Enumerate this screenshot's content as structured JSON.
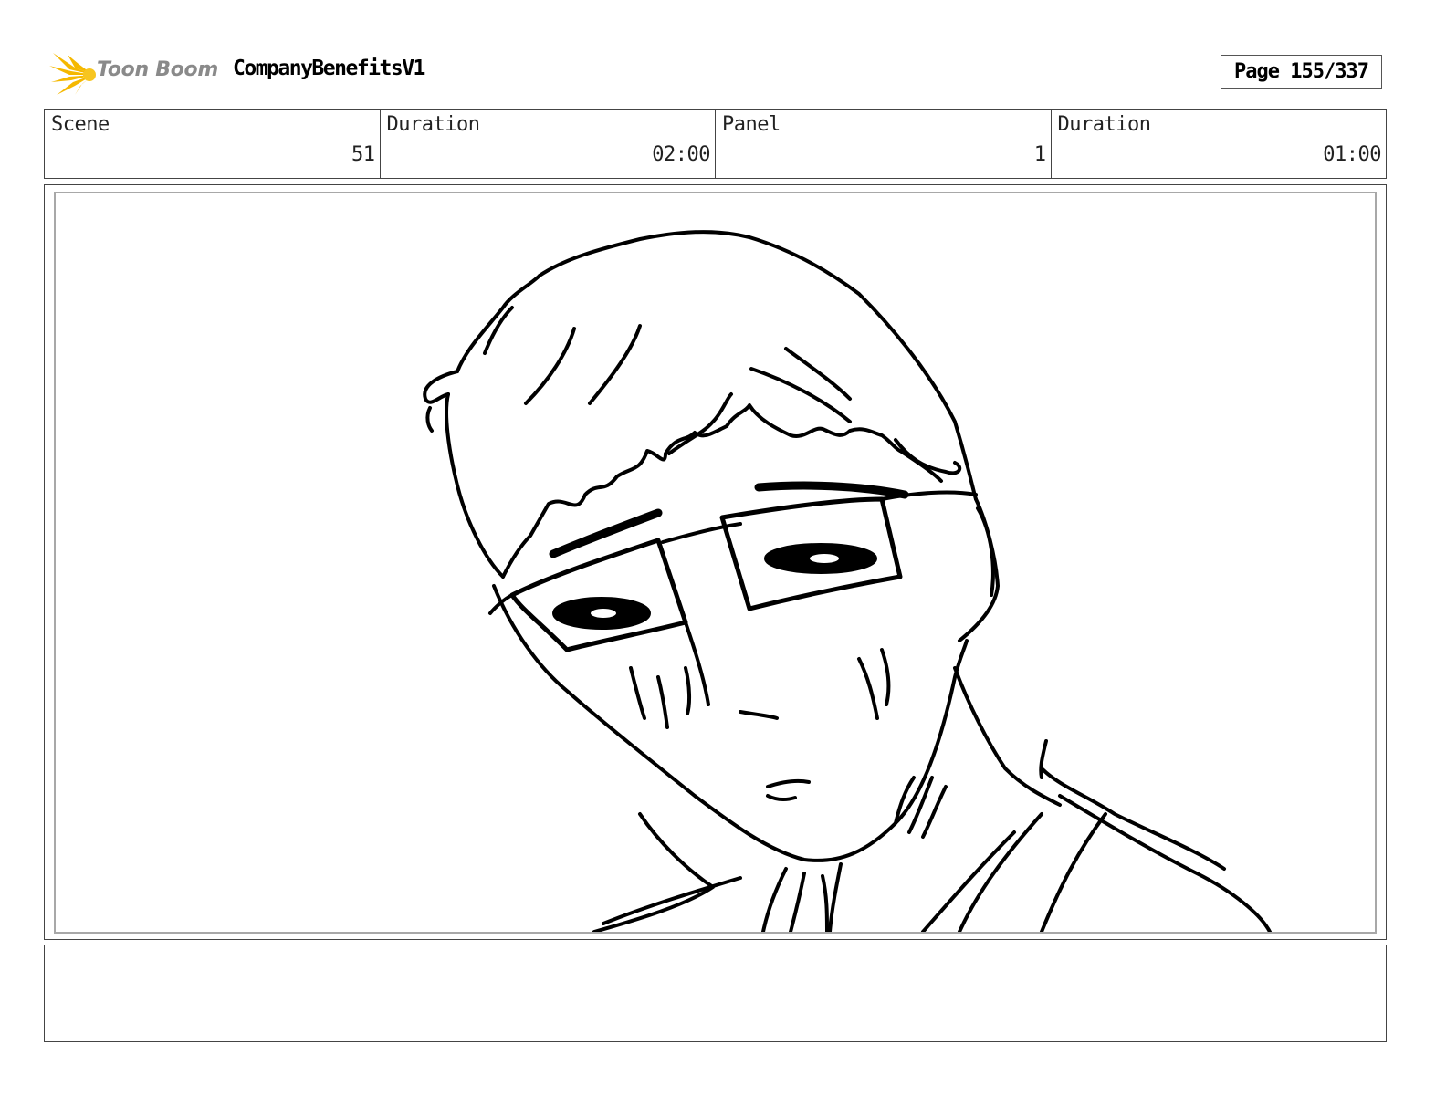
{
  "header": {
    "logo_text": "Toon Boom",
    "project_title": "CompanyBenefitsV1",
    "page_label": "Page 155/337"
  },
  "info": [
    {
      "label": "Scene",
      "value": "51"
    },
    {
      "label": "Duration",
      "value": "02:00"
    },
    {
      "label": "Panel",
      "value": "1"
    },
    {
      "label": "Duration",
      "value": "01:00"
    }
  ],
  "panel": {
    "drawing": "sketch-character-glasses"
  },
  "notes": {
    "text": ""
  },
  "colors": {
    "logo_accent": "#f5b800",
    "logo_text": "#8a8a8a",
    "border": "#444444",
    "panel_inner_border": "#a8a8a8"
  }
}
